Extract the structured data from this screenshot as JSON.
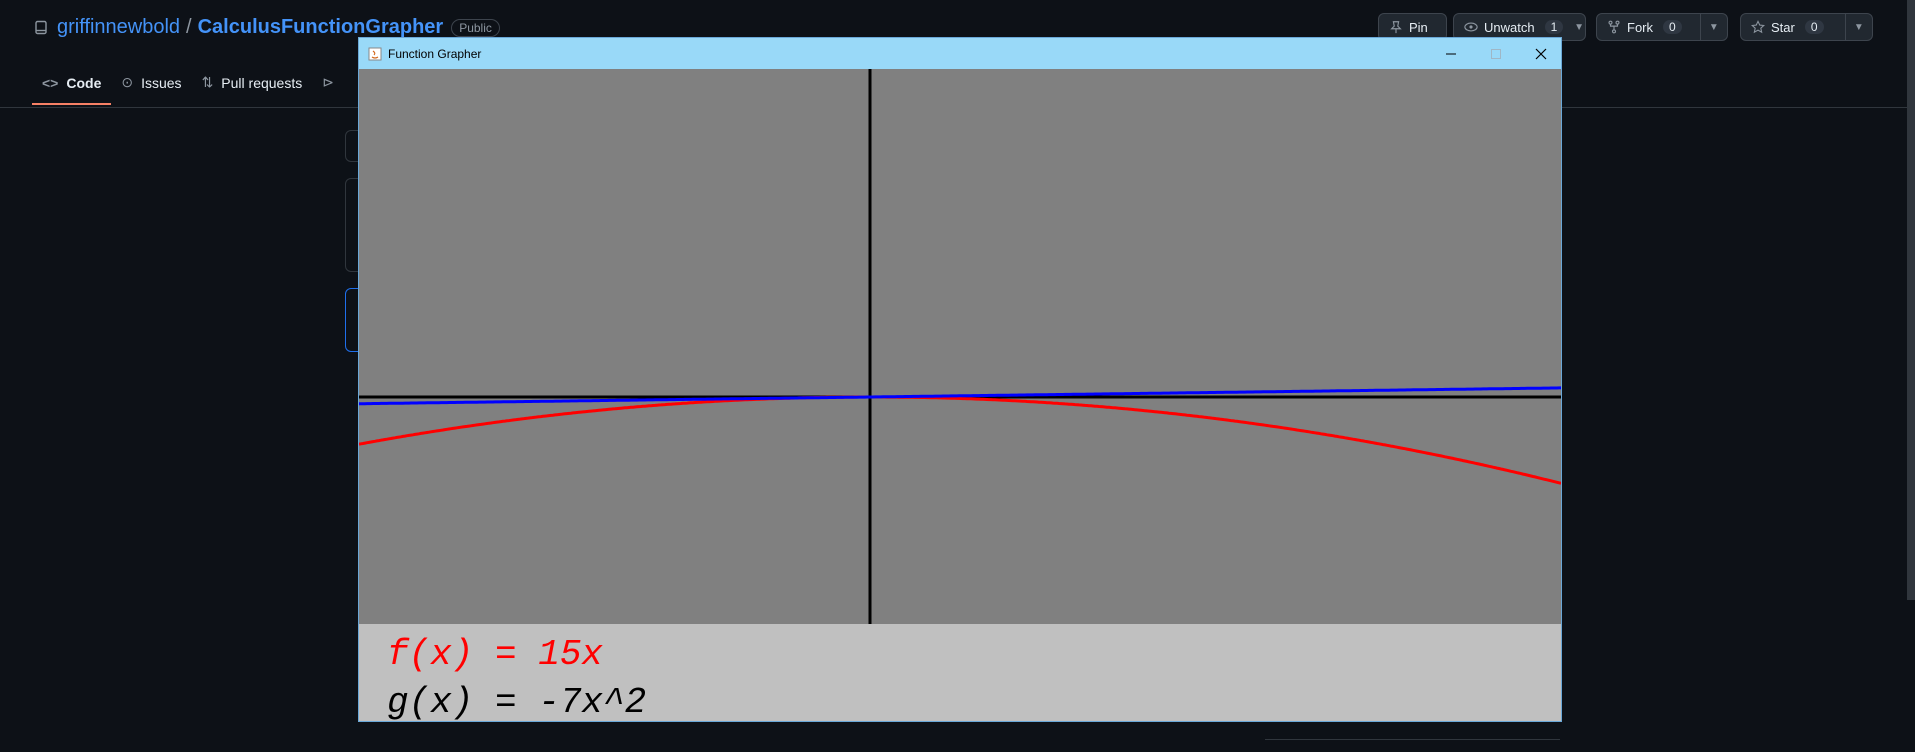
{
  "github": {
    "owner": "griffinnewbold",
    "separator": "/",
    "repo": "CalculusFunctionGrapher",
    "visibility": "Public",
    "actions": {
      "pin": "Pin",
      "unwatch": "Unwatch",
      "unwatch_count": "1",
      "fork": "Fork",
      "fork_count": "0",
      "star": "Star",
      "star_count": "0"
    },
    "tabs": [
      {
        "label": "Code",
        "icon": "code-icon",
        "active": true
      },
      {
        "label": "Issues",
        "icon": "issue-icon",
        "active": false
      },
      {
        "label": "Pull requests",
        "icon": "pull-request-icon",
        "active": false
      }
    ]
  },
  "window": {
    "title": "Function Grapher",
    "legend": {
      "f": "f(x) = 15x",
      "g": "g(x) = -7x^2"
    },
    "colors": {
      "f": "#0000ff",
      "g": "#ff0000",
      "f_label": "#ff0000",
      "g_label": "#000000",
      "plot_bg": "#808080",
      "axes": "#000000"
    }
  }
}
